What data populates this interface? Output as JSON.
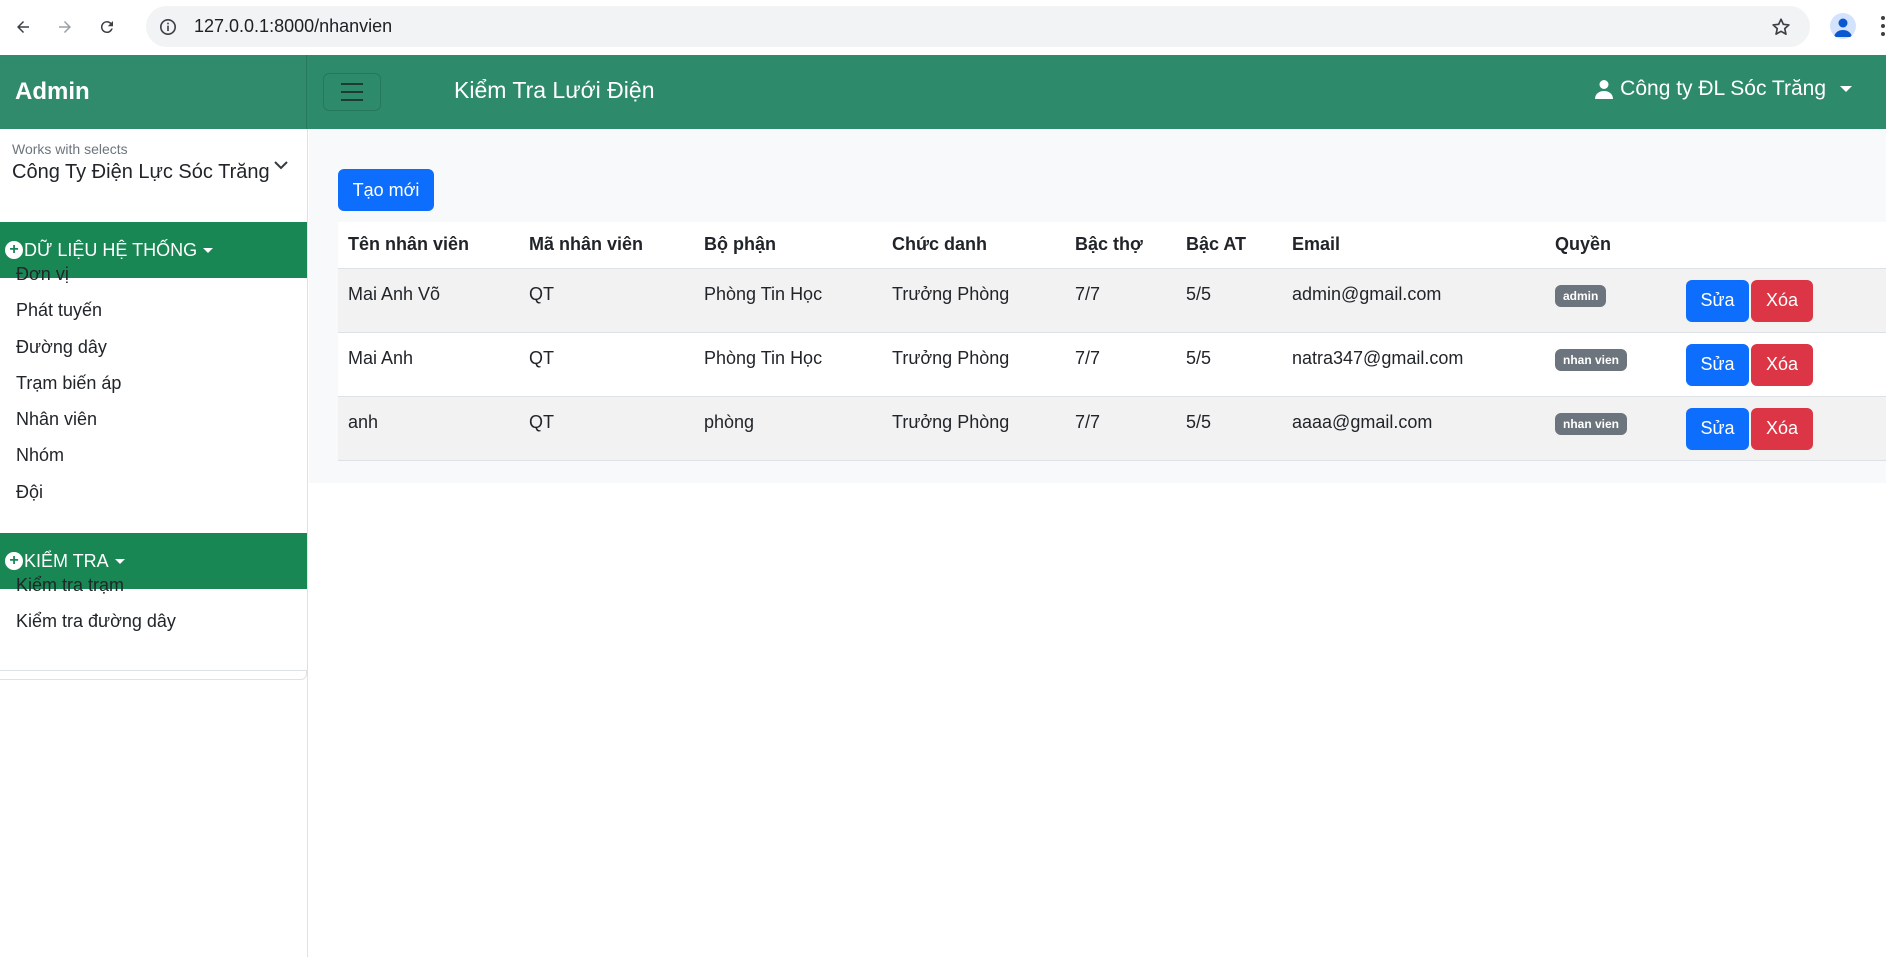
{
  "browser": {
    "url": "127.0.0.1:8000/nhanvien"
  },
  "header": {
    "brand": "Admin",
    "title": "Kiểm Tra Lưới Điện",
    "user": "Công ty ĐL Sóc Trăng",
    "accent_color": "#2d8a6a"
  },
  "sidebar": {
    "select_label": "Works with selects",
    "select_value": "Công Ty Điện Lực Sóc Trăng",
    "sections": [
      {
        "title": "DỮ LIỆU HỆ THỐNG",
        "items": [
          "Đơn vị",
          "Phát tuyến",
          "Đường dây",
          "Trạm biến áp",
          "Nhân viên",
          "Nhóm",
          "Đội"
        ]
      },
      {
        "title": "KIỂM TRA",
        "items": [
          "Kiểm tra trạm",
          "Kiểm tra đường dây"
        ]
      }
    ]
  },
  "main": {
    "create_button": "Tạo mới",
    "columns": [
      "Tên nhân viên",
      "Mã nhân viên",
      "Bộ phận",
      "Chức danh",
      "Bậc thợ",
      "Bậc AT",
      "Email",
      "Quyền",
      ""
    ],
    "rows": [
      {
        "name": "Mai Anh Võ",
        "code": "QT",
        "dept": "Phòng Tin Học",
        "title": "Trưởng Phòng",
        "bac_tho": "7/7",
        "bac_at": "5/5",
        "email": "admin@gmail.com",
        "role": "admin",
        "edit": "Sửa",
        "delete": "Xóa"
      },
      {
        "name": "Mai Anh",
        "code": "QT",
        "dept": "Phòng Tin Học",
        "title": "Trưởng Phòng",
        "bac_tho": "7/7",
        "bac_at": "5/5",
        "email": "natra347@gmail.com",
        "role": "nhan vien",
        "edit": "Sửa",
        "delete": "Xóa"
      },
      {
        "name": "anh",
        "code": "QT",
        "dept": "phòng",
        "title": "Trưởng Phòng",
        "bac_tho": "7/7",
        "bac_at": "5/5",
        "email": "aaaa@gmail.com",
        "role": "nhan vien",
        "edit": "Sửa",
        "delete": "Xóa"
      }
    ]
  }
}
